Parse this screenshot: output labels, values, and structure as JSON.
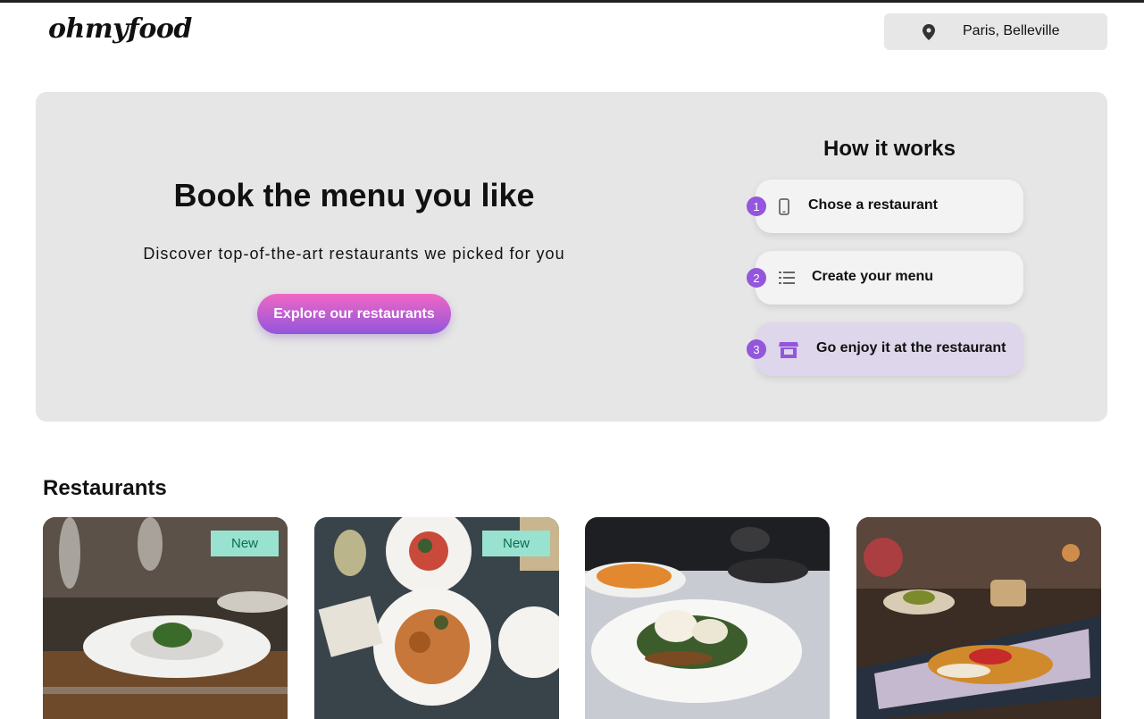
{
  "header": {
    "logo": "ohmyfood",
    "location": "Paris, Belleville",
    "location_icon": "map-pin-icon"
  },
  "hero": {
    "title": "Book the menu you like",
    "subtitle": "Discover top-of-the-art restaurants we picked for you",
    "cta_label": "Explore our restaurants"
  },
  "how_it_works": {
    "title": "How it works",
    "steps": [
      {
        "number": "1",
        "label": "Chose a restaurant",
        "icon": "mobile-phone-icon"
      },
      {
        "number": "2",
        "label": "Create your menu",
        "icon": "list-icon"
      },
      {
        "number": "3",
        "label": "Go enjoy it at the restaurant",
        "icon": "store-icon"
      }
    ]
  },
  "restaurants": {
    "title": "Restaurants",
    "cards": [
      {
        "badge": "New",
        "photo": "dining-table-plate-photo"
      },
      {
        "badge": "New",
        "photo": "top-down-plates-photo"
      },
      {
        "badge": "",
        "photo": "poached-egg-plate-photo"
      },
      {
        "badge": "",
        "photo": "long-plate-dish-photo"
      }
    ]
  },
  "colors": {
    "accent_purple": "#9356dc",
    "accent_pink": "#ef67c4",
    "badge_bg": "#99e2d0",
    "badge_text": "#0c6c54",
    "hero_bg": "#e6e6e6"
  }
}
